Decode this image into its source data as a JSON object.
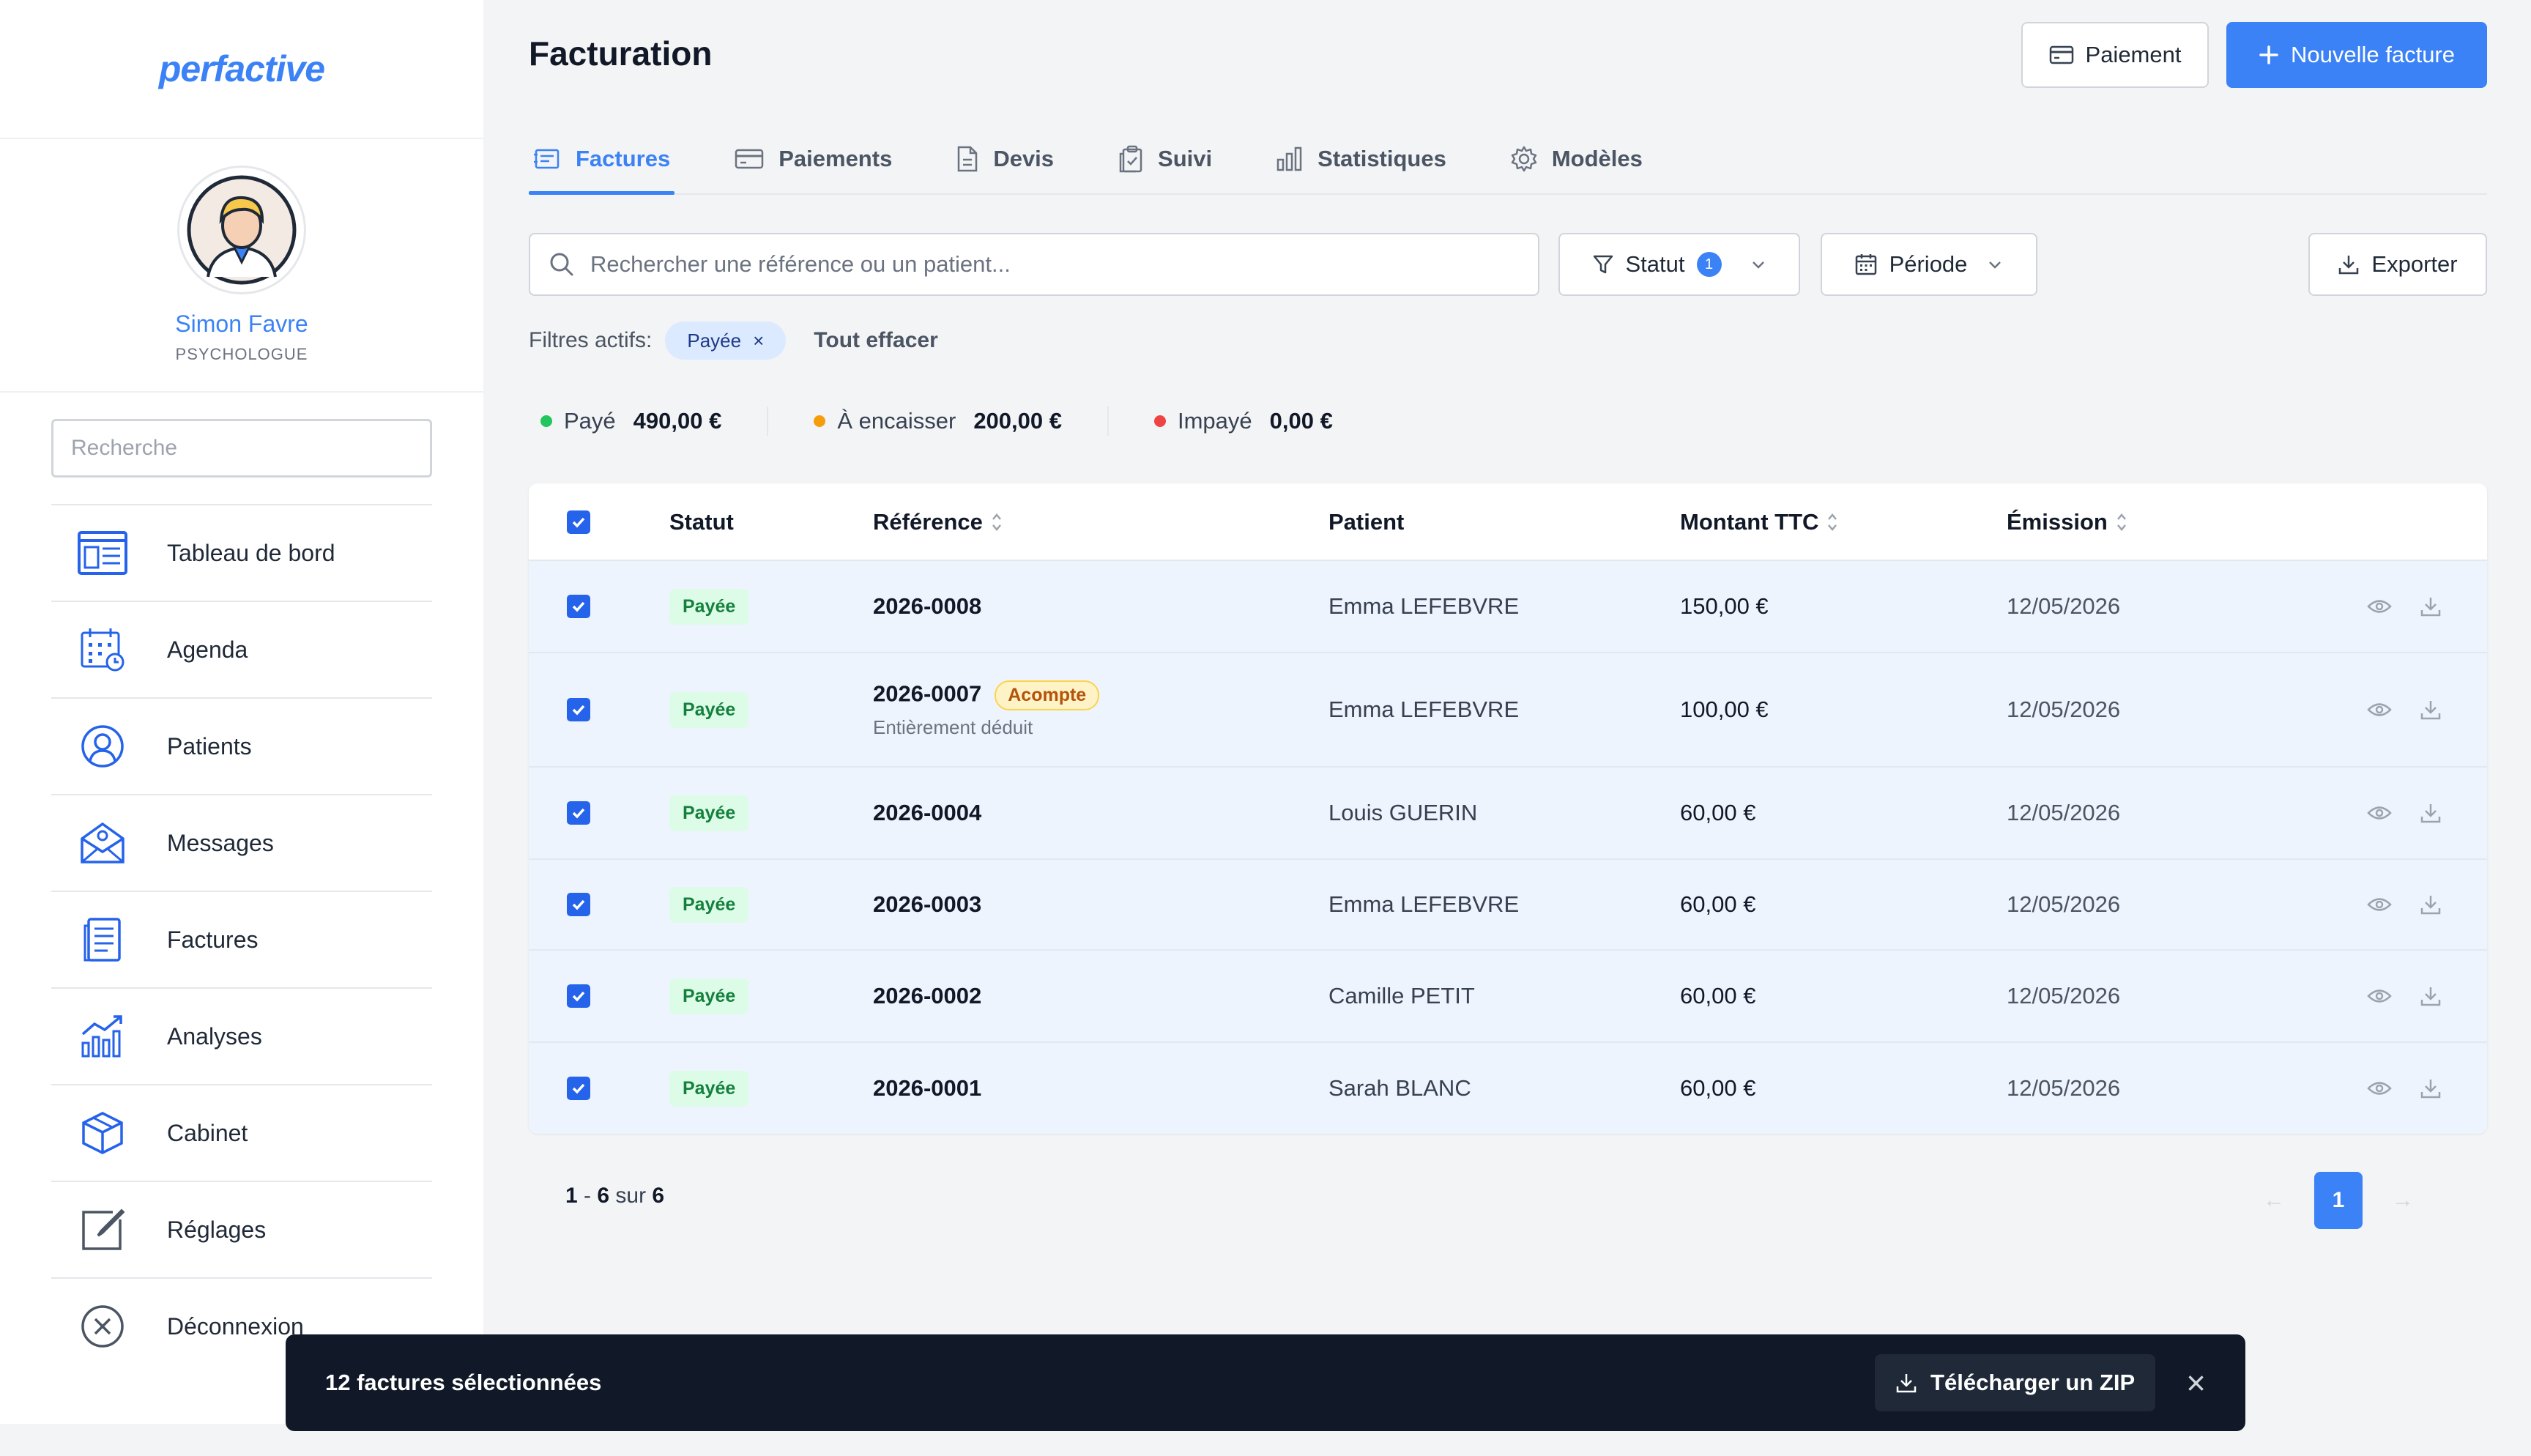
{
  "brand": {
    "logo_text": "perfactive",
    "accent": "#3b82f6"
  },
  "profile": {
    "name": "Simon Favre",
    "role": "PSYCHOLOGUE"
  },
  "sidebar": {
    "search_placeholder": "Recherche",
    "items": [
      {
        "label": "Tableau de bord",
        "icon": "dashboard-icon"
      },
      {
        "label": "Agenda",
        "icon": "calendar-icon"
      },
      {
        "label": "Patients",
        "icon": "user-circle-icon"
      },
      {
        "label": "Messages",
        "icon": "mail-icon"
      },
      {
        "label": "Factures",
        "icon": "document-icon"
      },
      {
        "label": "Analyses",
        "icon": "chart-icon"
      },
      {
        "label": "Cabinet",
        "icon": "box-icon"
      },
      {
        "label": "Réglages",
        "icon": "edit-icon"
      },
      {
        "label": "Déconnexion",
        "icon": "close-circle-icon"
      }
    ]
  },
  "header": {
    "title": "Facturation",
    "payment_button": "Paiement",
    "new_invoice_button": "Nouvelle facture"
  },
  "tabs": [
    {
      "label": "Factures",
      "icon": "invoice-icon",
      "active": true
    },
    {
      "label": "Paiements",
      "icon": "card-icon",
      "active": false
    },
    {
      "label": "Devis",
      "icon": "file-icon",
      "active": false
    },
    {
      "label": "Suivi",
      "icon": "clipboard-icon",
      "active": false
    },
    {
      "label": "Statistiques",
      "icon": "bar-chart-icon",
      "active": false
    },
    {
      "label": "Modèles",
      "icon": "gear-icon",
      "active": false
    }
  ],
  "toolbar": {
    "search_placeholder": "Rechercher une référence ou un patient...",
    "status_label": "Statut",
    "status_count": "1",
    "period_label": "Période",
    "export_label": "Exporter"
  },
  "filters": {
    "label": "Filtres actifs:",
    "chip": "Payée",
    "chip_remove": "×",
    "clear_all": "Tout effacer"
  },
  "summary": [
    {
      "label": "Payé",
      "value": "490,00 €",
      "color": "#22c55e"
    },
    {
      "label": "À encaisser",
      "value": "200,00 €",
      "color": "#f59e0b"
    },
    {
      "label": "Impayé",
      "value": "0,00 €",
      "color": "#ef4444"
    }
  ],
  "table": {
    "headers": {
      "status": "Statut",
      "reference": "Référence",
      "patient": "Patient",
      "amount": "Montant TTC",
      "date": "Émission"
    },
    "rows": [
      {
        "status": "Payée",
        "reference": "2026-0008",
        "patient": "Emma LEFEBVRE",
        "amount": "150,00 €",
        "date": "12/05/2026"
      },
      {
        "status": "Payée",
        "reference": "2026-0007",
        "badge": "Acompte",
        "sub": "Entièrement déduit",
        "patient": "Emma LEFEBVRE",
        "amount": "100,00 €",
        "date": "12/05/2026"
      },
      {
        "status": "Payée",
        "reference": "2026-0004",
        "patient": "Louis GUERIN",
        "amount": "60,00 €",
        "date": "12/05/2026"
      },
      {
        "status": "Payée",
        "reference": "2026-0003",
        "patient": "Emma LEFEBVRE",
        "amount": "60,00 €",
        "date": "12/05/2026"
      },
      {
        "status": "Payée",
        "reference": "2026-0002",
        "patient": "Camille PETIT",
        "amount": "60,00 €",
        "date": "12/05/2026"
      },
      {
        "status": "Payée",
        "reference": "2026-0001",
        "patient": "Sarah BLANC",
        "amount": "60,00 €",
        "date": "12/05/2026"
      }
    ]
  },
  "pagination": {
    "from": "1",
    "dash": " - ",
    "to": "6",
    "of_label": " sur ",
    "total": "6",
    "current_page": "1",
    "prev": "←",
    "next": "→"
  },
  "selection_bar": {
    "text": "12 factures sélectionnées",
    "zip_label": "Télécharger un ZIP",
    "close": "×"
  }
}
